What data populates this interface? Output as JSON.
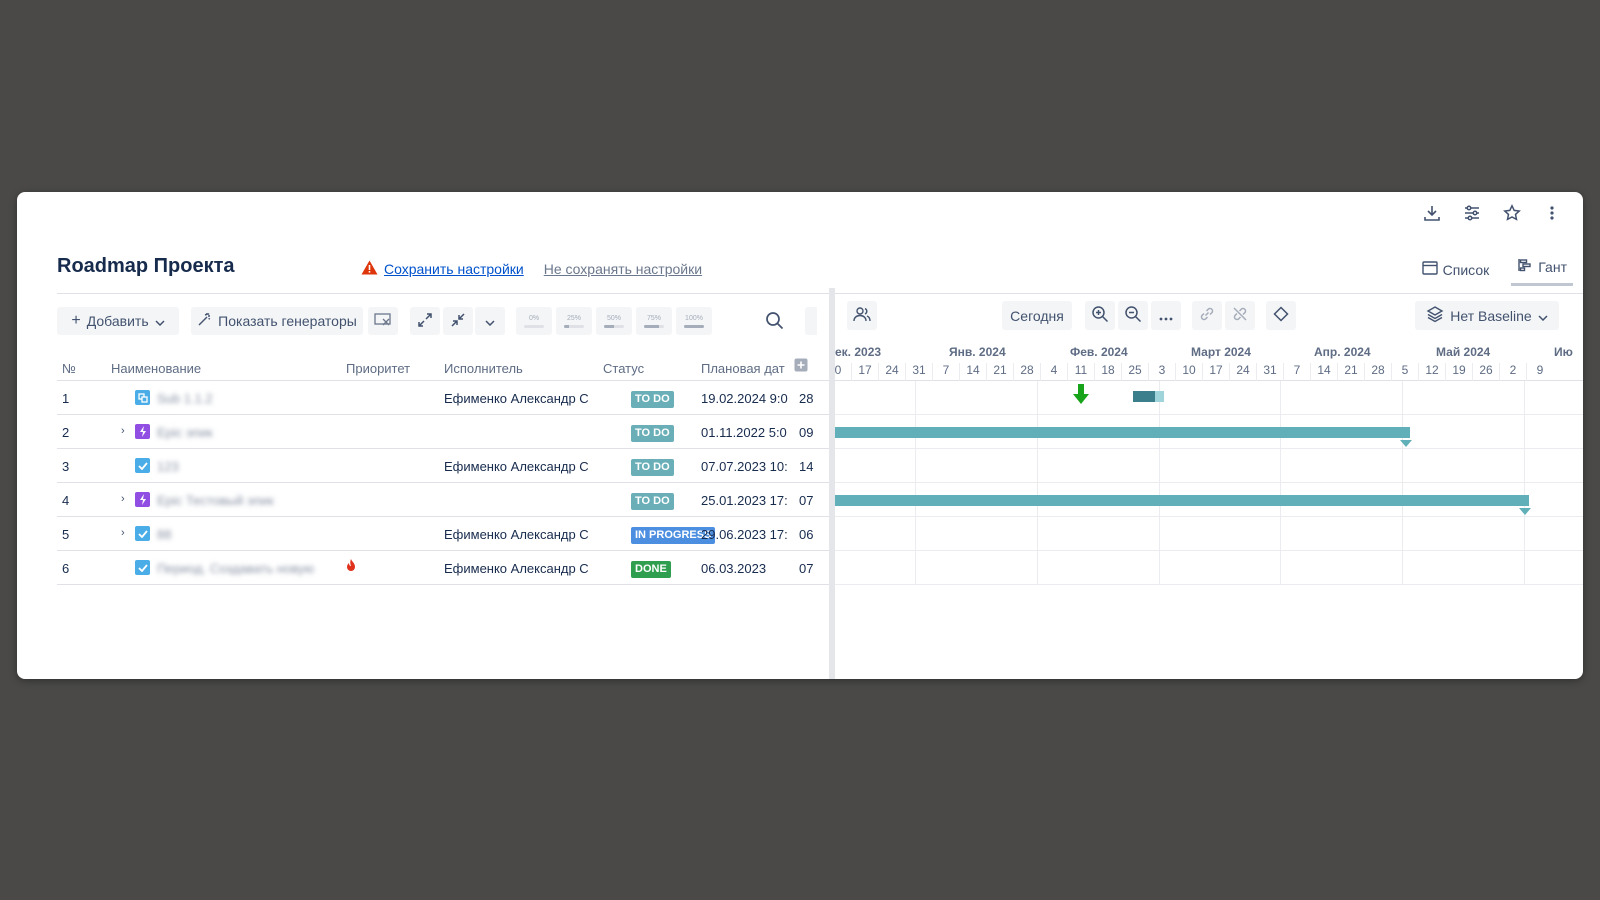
{
  "page": {
    "title": "Roadmap Проекта",
    "save_settings": "Сохранить настройки",
    "dont_save_settings": "Не сохранять настройки"
  },
  "top_icons": [
    "download-icon",
    "settings-sliders-icon",
    "star-icon",
    "more-vertical-icon"
  ],
  "views": {
    "list": "Список",
    "gantt": "Гант",
    "active": "Гант"
  },
  "toolbar": {
    "add": "Добавить",
    "show_generators": "Показать генераторы",
    "progress_levels": [
      "0%",
      "25%",
      "50%",
      "75%",
      "100%"
    ]
  },
  "table": {
    "headers": {
      "num": "№",
      "name": "Наименование",
      "priority": "Приоритет",
      "assignee": "Исполнитель",
      "status": "Статус",
      "planned_date": "Плановая дат"
    },
    "rows": [
      {
        "num": "1",
        "type": "subtask",
        "name": "Sub 1.1.2",
        "assignee": "Ефименко Александр С",
        "status": "TO DO",
        "planned": "19.02.2024 9:0",
        "next": "28"
      },
      {
        "num": "2",
        "type": "epic",
        "expandable": true,
        "name": "Epic эпик",
        "assignee": "",
        "status": "TO DO",
        "planned": "01.11.2022 5:0",
        "next": "09"
      },
      {
        "num": "3",
        "type": "task",
        "name": "123",
        "assignee": "Ефименко Александр С",
        "status": "TO DO",
        "planned": "07.07.2023 10:",
        "next": "14"
      },
      {
        "num": "4",
        "type": "epic",
        "expandable": true,
        "name": "Epic Тестовый эпик",
        "assignee": "",
        "status": "TO DO",
        "planned": "25.01.2023 17:",
        "next": "07"
      },
      {
        "num": "5",
        "type": "task",
        "expandable": true,
        "name": "88",
        "assignee": "Ефименко Александр С",
        "status": "IN PROGRESS",
        "planned": "29.06.2023 17:",
        "next": "06"
      },
      {
        "num": "6",
        "type": "task",
        "name": "Период. Создавать новую",
        "priority": "highest",
        "assignee": "Ефименко Александр С",
        "status": "DONE",
        "planned": "06.03.2023",
        "next": "07"
      }
    ]
  },
  "gantt": {
    "today": "Сегодня",
    "baseline": "Нет Baseline",
    "months": [
      "ек. 2023",
      "Янв. 2024",
      "Фев. 2024",
      "Март 2024",
      "Апр. 2024",
      "Май 2024",
      "Ию"
    ],
    "weeks": [
      "0",
      "17",
      "24",
      "31",
      "7",
      "14",
      "21",
      "28",
      "4",
      "11",
      "18",
      "25",
      "3",
      "10",
      "17",
      "24",
      "31",
      "7",
      "14",
      "21",
      "28",
      "5",
      "12",
      "19",
      "26",
      "2",
      "9"
    ]
  },
  "colors": {
    "todo": "#6aafb8",
    "in_progress": "#4c8fe0",
    "done": "#2f9e4f",
    "bar": "#61b0b9",
    "link": "#0052cc",
    "warning": "#de350b"
  }
}
